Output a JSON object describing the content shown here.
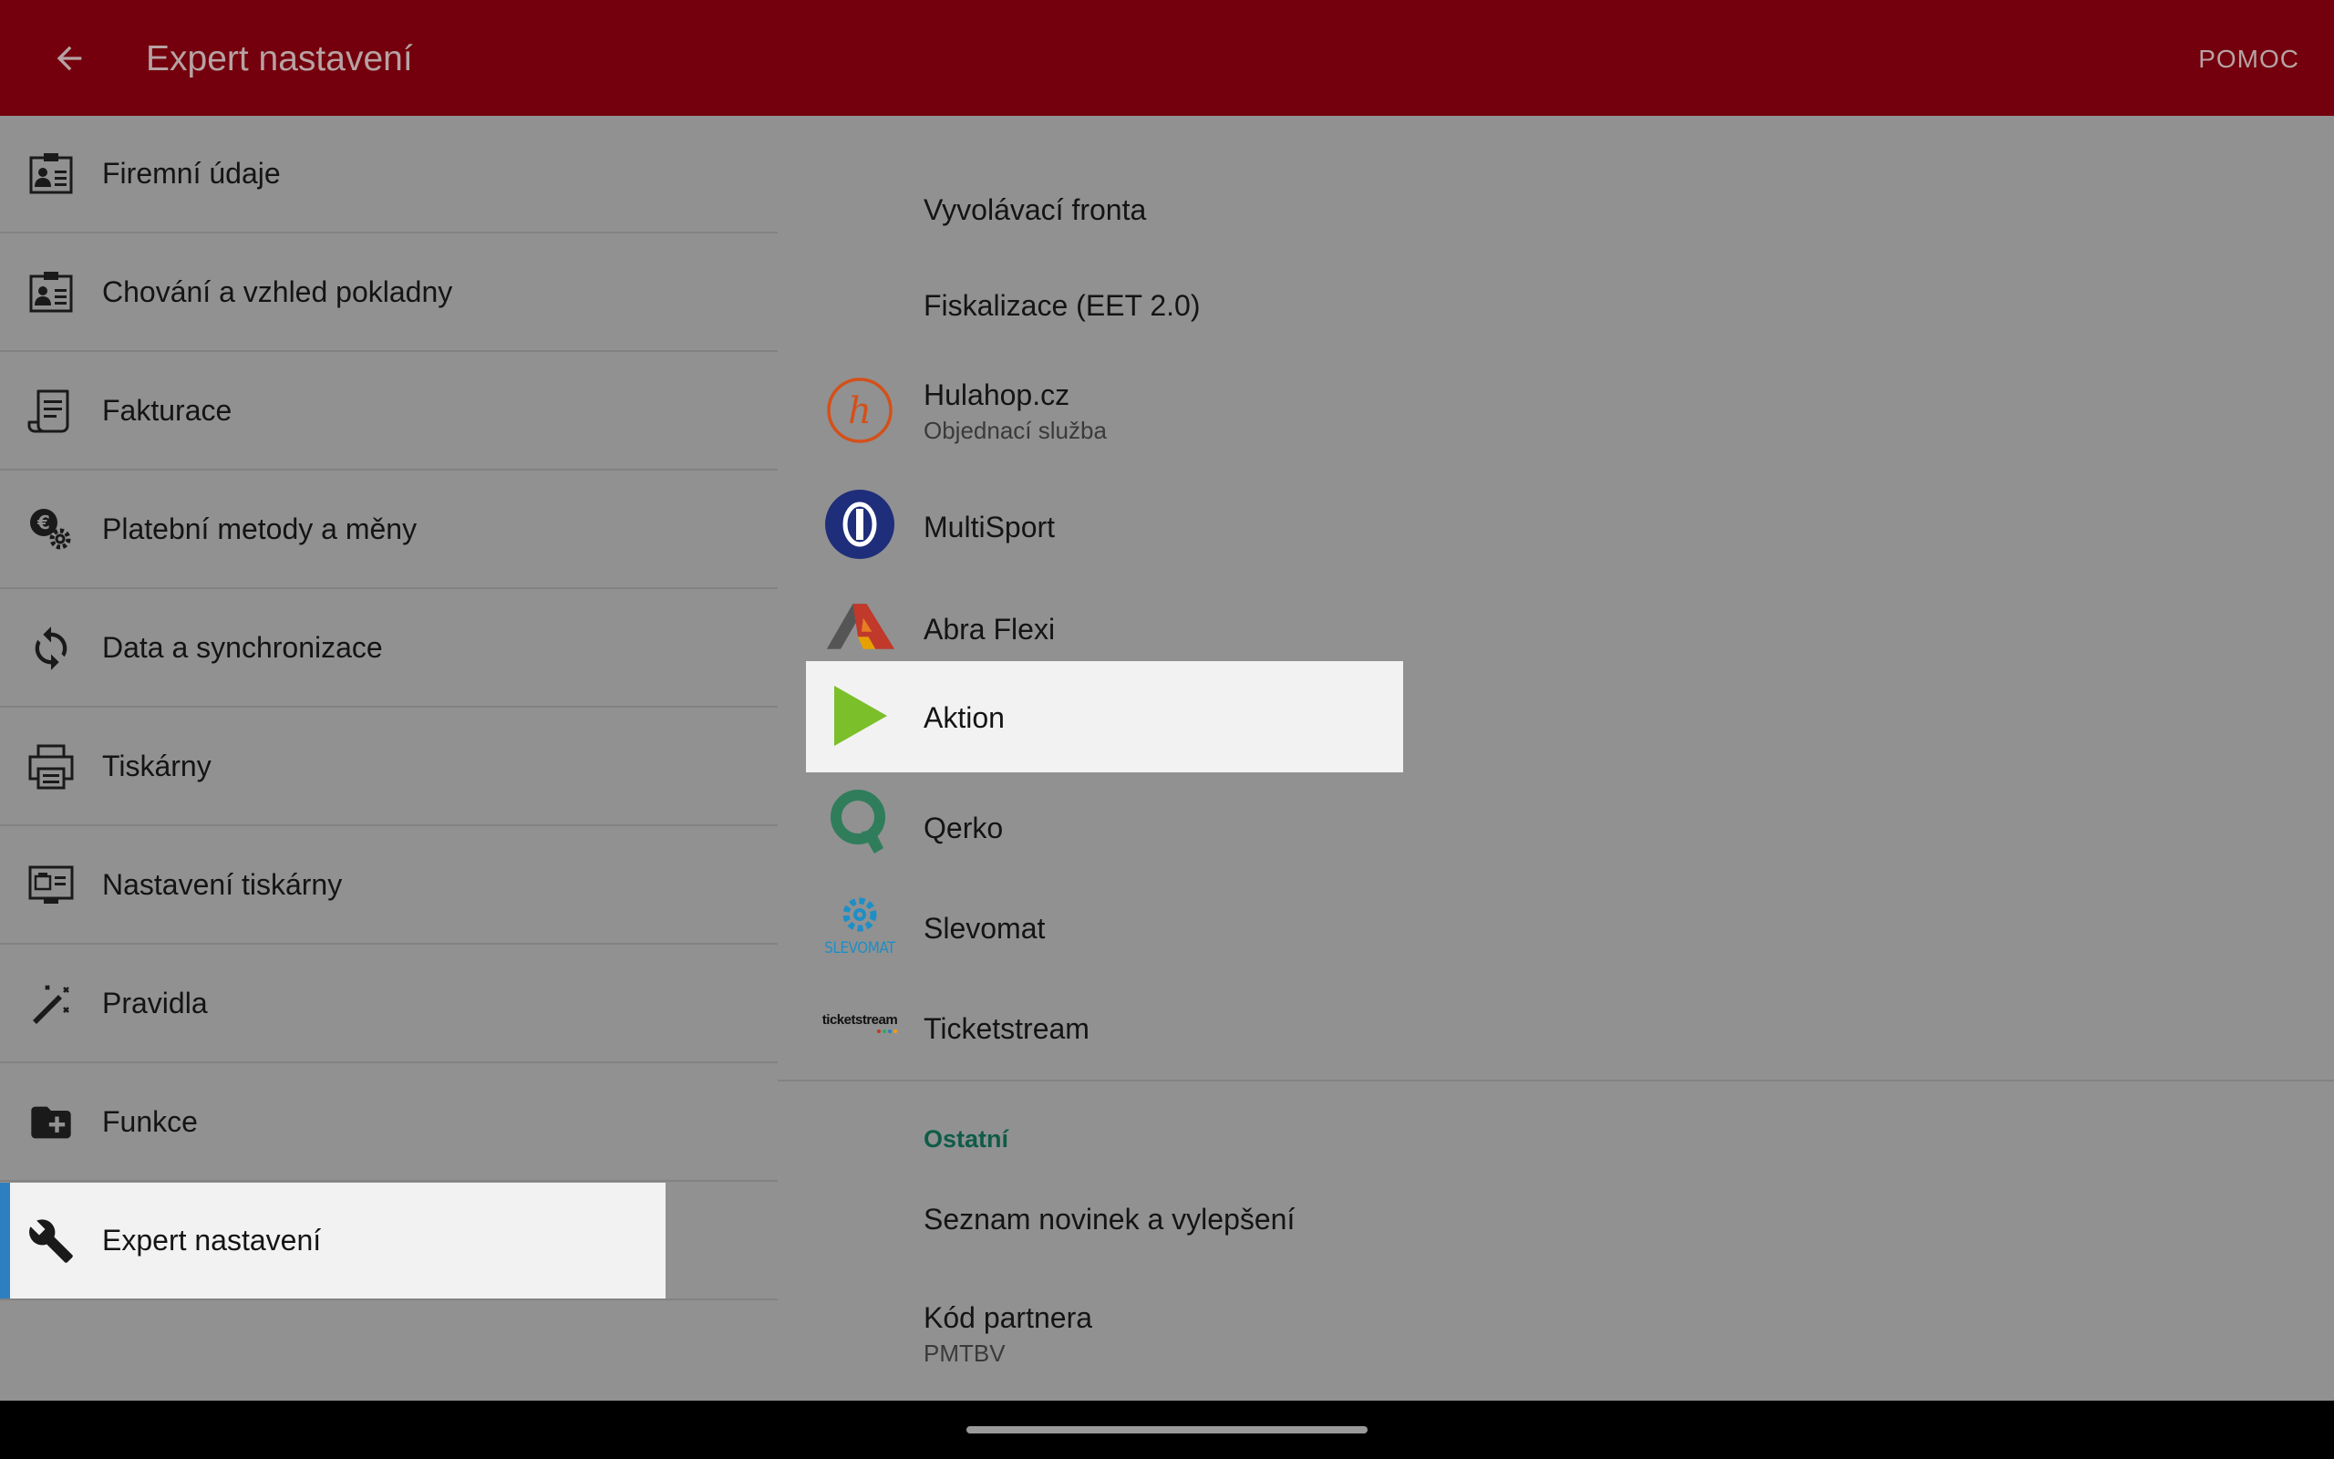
{
  "appbar": {
    "title": "Expert nastavení",
    "help_label": "POMOC"
  },
  "sidebar": {
    "items": [
      {
        "label": "Firemní údaje",
        "icon": "id-card-icon"
      },
      {
        "label": "Chování a vzhled pokladny",
        "icon": "id-card-icon"
      },
      {
        "label": "Fakturace",
        "icon": "invoice-icon"
      },
      {
        "label": "Platební metody a měny",
        "icon": "euro-gear-icon"
      },
      {
        "label": "Data a synchronizace",
        "icon": "sync-icon"
      },
      {
        "label": "Tiskárny",
        "icon": "printer-icon"
      },
      {
        "label": "Nastavení tiskárny",
        "icon": "printer-settings-icon"
      },
      {
        "label": "Pravidla",
        "icon": "magic-wand-icon"
      },
      {
        "label": "Funkce",
        "icon": "folder-add-icon"
      },
      {
        "label": "Expert nastavení",
        "icon": "wrench-icon",
        "selected": true
      }
    ]
  },
  "main": {
    "items": [
      {
        "title": "Vyvolávací fronta"
      },
      {
        "title": "Fiskalizace (EET 2.0)"
      },
      {
        "title": "Hulahop.cz",
        "subtitle": "Objednací služba",
        "logo": "hulahop-logo-icon"
      },
      {
        "title": "MultiSport",
        "logo": "multisport-logo-icon"
      },
      {
        "title": "Abra Flexi",
        "logo": "abra-flexi-logo-icon"
      },
      {
        "title": "Aktion",
        "logo": "aktion-logo-icon",
        "highlighted": true
      },
      {
        "title": "Qerko",
        "logo": "qerko-logo-icon"
      },
      {
        "title": "Slevomat",
        "logo": "slevomat-logo-icon",
        "logo_text": "SLEVOMAT"
      },
      {
        "title": "Ticketstream",
        "logo": "ticketstream-logo-icon",
        "logo_text": "ticketstream"
      }
    ],
    "section_other": {
      "header": "Ostatní",
      "items": [
        {
          "title": "Seznam novinek a vylepšení"
        },
        {
          "title": "Kód partnera",
          "subtitle": "PMTBV"
        }
      ]
    }
  },
  "colors": {
    "appbar": "#73000c",
    "content_bg": "#919191",
    "selected_bg": "#f2f2f2",
    "selected_accent": "#2d7fc0",
    "section_header": "#0f5c48"
  }
}
